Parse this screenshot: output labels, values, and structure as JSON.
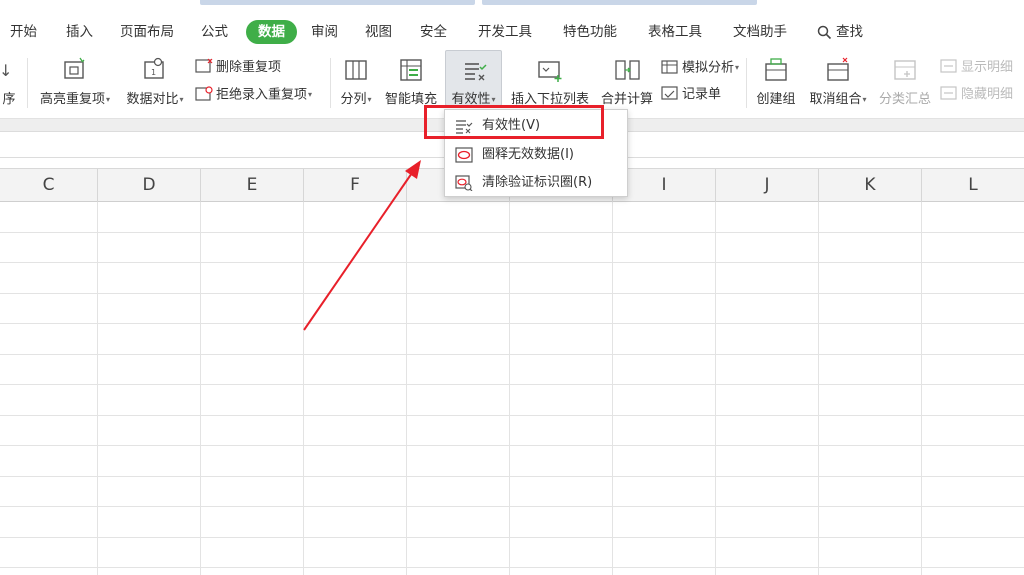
{
  "tabs": [
    "开始",
    "插入",
    "页面布局",
    "公式",
    "数据",
    "审阅",
    "视图",
    "安全",
    "开发工具",
    "特色功能",
    "表格工具",
    "文档助手",
    "查找"
  ],
  "ribbon": {
    "sort_label": "序",
    "highlight_dup": "高亮重复项",
    "data_compare": "数据对比",
    "delete_dup": "删除重复项",
    "reject_dup": "拒绝录入重复项",
    "split": "分列",
    "smart_fill": "智能填充",
    "validity": "有效性",
    "insert_dropdown": "插入下拉列表",
    "merge_calc": "合并计算",
    "what_if": "模拟分析",
    "record_form": "记录单",
    "create_group": "创建组",
    "ungroup": "取消组合",
    "subtotal": "分类汇总",
    "show_detail": "显示明细",
    "hide_detail": "隐藏明细"
  },
  "columns": [
    "C",
    "D",
    "E",
    "F",
    "G",
    "H",
    "I",
    "J",
    "K",
    "L"
  ],
  "menu": {
    "items": [
      "有效性(V)",
      "圈释无效数据(I)",
      "清除验证标识圈(R)"
    ]
  },
  "colors": {
    "accent": "#3fae48",
    "highlight": "#e8202a"
  }
}
